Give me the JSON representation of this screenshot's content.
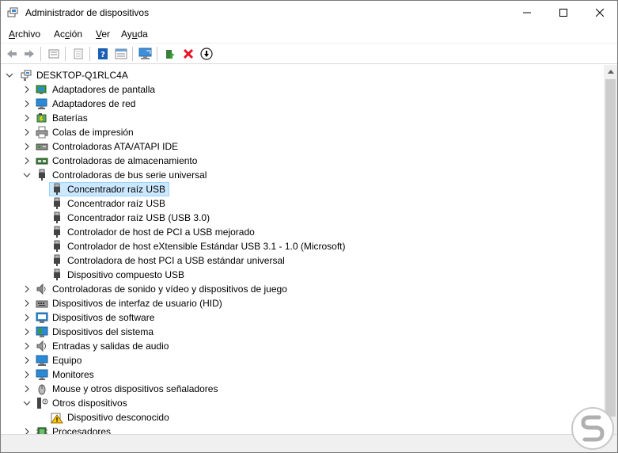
{
  "window": {
    "title": "Administrador de dispositivos"
  },
  "menu": [
    {
      "pre": "",
      "u": "A",
      "post": "rchivo"
    },
    {
      "pre": "Ac",
      "u": "c",
      "post": "ión"
    },
    {
      "pre": "",
      "u": "V",
      "post": "er"
    },
    {
      "pre": "Ay",
      "u": "u",
      "post": "da"
    }
  ],
  "toolbar": {
    "icons": [
      "back-icon",
      "forward-icon",
      "properties-icon",
      "print-icon",
      "help-icon",
      "show-hidden-icon",
      "scan-hardware-icon",
      "update-driver-icon",
      "uninstall-icon",
      "disable-device-icon"
    ]
  },
  "tree": {
    "root": "DESKTOP-Q1RLC4A",
    "items": [
      {
        "label": "Adaptadores de pantalla",
        "level": 1,
        "state": "collapsed",
        "icon": "display-adapter-icon"
      },
      {
        "label": "Adaptadores de red",
        "level": 1,
        "state": "collapsed",
        "icon": "network-adapter-icon"
      },
      {
        "label": "Baterías",
        "level": 1,
        "state": "collapsed",
        "icon": "battery-icon"
      },
      {
        "label": "Colas de impresión",
        "level": 1,
        "state": "collapsed",
        "icon": "printer-icon"
      },
      {
        "label": "Controladoras ATA/ATAPI IDE",
        "level": 1,
        "state": "collapsed",
        "icon": "ide-controller-icon"
      },
      {
        "label": "Controladoras de almacenamiento",
        "level": 1,
        "state": "collapsed",
        "icon": "storage-controller-icon"
      },
      {
        "label": "Controladoras de bus serie universal",
        "level": 1,
        "state": "expanded",
        "icon": "usb-icon"
      },
      {
        "label": "Concentrador raíz USB",
        "level": 2,
        "state": "leaf",
        "icon": "usb-icon",
        "selected": true
      },
      {
        "label": "Concentrador raíz USB",
        "level": 2,
        "state": "leaf",
        "icon": "usb-icon"
      },
      {
        "label": "Concentrador raíz USB (USB 3.0)",
        "level": 2,
        "state": "leaf",
        "icon": "usb-icon"
      },
      {
        "label": "Controlador de host de PCI a USB mejorado",
        "level": 2,
        "state": "leaf",
        "icon": "usb-icon"
      },
      {
        "label": "Controlador de host eXtensible Estándar USB 3.1 - 1.0 (Microsoft)",
        "level": 2,
        "state": "leaf",
        "icon": "usb-icon"
      },
      {
        "label": "Controladora de host PCI a USB estándar universal",
        "level": 2,
        "state": "leaf",
        "icon": "usb-icon"
      },
      {
        "label": "Dispositivo compuesto USB",
        "level": 2,
        "state": "leaf",
        "icon": "usb-icon"
      },
      {
        "label": "Controladoras de sonido y vídeo y dispositivos de juego",
        "level": 1,
        "state": "collapsed",
        "icon": "sound-icon"
      },
      {
        "label": "Dispositivos de interfaz de usuario (HID)",
        "level": 1,
        "state": "collapsed",
        "icon": "hid-icon"
      },
      {
        "label": "Dispositivos de software",
        "level": 1,
        "state": "collapsed",
        "icon": "software-device-icon"
      },
      {
        "label": "Dispositivos del sistema",
        "level": 1,
        "state": "collapsed",
        "icon": "system-device-icon"
      },
      {
        "label": "Entradas y salidas de audio",
        "level": 1,
        "state": "collapsed",
        "icon": "audio-io-icon"
      },
      {
        "label": "Equipo",
        "level": 1,
        "state": "collapsed",
        "icon": "computer-icon"
      },
      {
        "label": "Monitores",
        "level": 1,
        "state": "collapsed",
        "icon": "monitor-icon"
      },
      {
        "label": "Mouse y otros dispositivos señaladores",
        "level": 1,
        "state": "collapsed",
        "icon": "mouse-icon"
      },
      {
        "label": "Otros dispositivos",
        "level": 1,
        "state": "expanded",
        "icon": "other-devices-icon"
      },
      {
        "label": "Dispositivo desconocido",
        "level": 2,
        "state": "leaf",
        "icon": "unknown-device-warning-icon"
      },
      {
        "label": "Procesadores",
        "level": 1,
        "state": "collapsed",
        "icon": "processor-icon"
      }
    ]
  },
  "colors": {
    "selection_bg": "#cce8ff",
    "selection_border": "#99d1ff",
    "uninstall_red": "#e81123",
    "help_blue": "#1a5fb4",
    "monitor_blue": "#2b8ad6"
  }
}
